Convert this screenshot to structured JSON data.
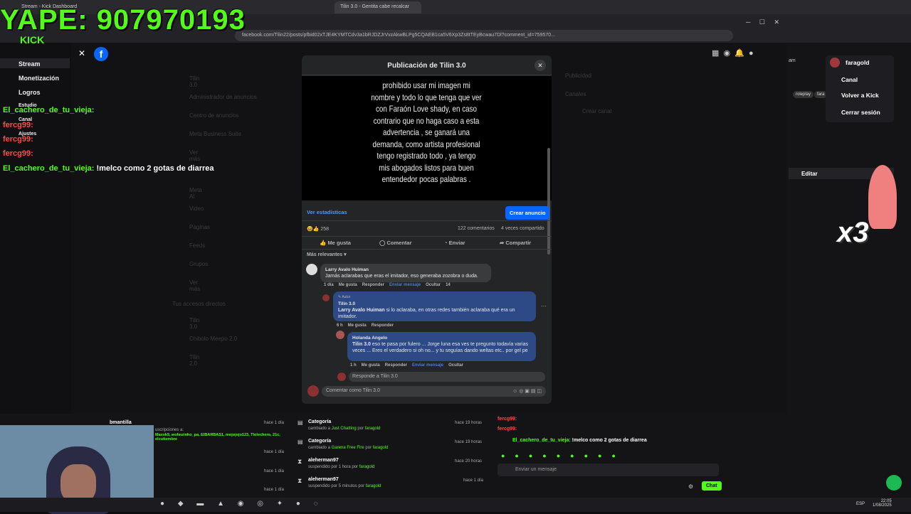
{
  "browser": {
    "tabs": [
      "Stream - Kick Dashboard",
      "Tilin 3.0 - Gentita cabe recalcar"
    ],
    "url": "facebook.com/Tilin22/posts/pfbid02xTJE4KYMTCdv3a1bRJDZJrVvzAkwBLPg5CQAEB1ca5V6Xp3Zs8tTEyBcwau7Dl?comment_id=759570..."
  },
  "overlay": {
    "yape": "YAPE: 907970193",
    "kick_logo": "KICK"
  },
  "kick_nav": [
    "Stream",
    "Monetización",
    "Logros",
    "Estudio",
    "Canal",
    "Ajustes"
  ],
  "chat_overlay": [
    {
      "user": "El_cachero_de_tu_vieja:",
      "text": ""
    },
    {
      "user": "fercg99:",
      "text": ""
    },
    {
      "user": "fercg99:",
      "text": ""
    },
    {
      "user": "fercg99:",
      "text": ""
    },
    {
      "user": "El_cachero_de_tu_vieja:",
      "text": "!melco como 2 gotas de diarrea"
    }
  ],
  "fb_sidebar": [
    "Tilin 3.0",
    "Administrador de anuncios",
    "Centro de anuncios",
    "Meta Business Suite",
    "Ver más",
    "Meta AI",
    "Video",
    "Páginas",
    "Feeds",
    "Grupos",
    "Ver más",
    "Tus accesos directos",
    "Tilin 3.0",
    "Chibolo Meepo 2.0",
    "Tilin 2.0"
  ],
  "fb_right": [
    "Publicidad",
    "Canales",
    "Crear canal"
  ],
  "modal": {
    "title": "Publicación de Tilin 3.0",
    "poem": "prohibido usar mi imagen mi nombre y todo lo que tenga que ver con Faraón Love shady, en caso contrario que no haga caso a esta advertencia , se ganará una demanda, como artista profesional tengo registrado todo , ya tengo mis abogados listos para buen entendedor pocas palabras .",
    "stats_link": "Ver estadísticas",
    "ad_button": "Crear anuncio",
    "reactions": "258",
    "comments_count": "122 comentarios",
    "shares": "4 veces compartido",
    "actions": [
      "Me gusta",
      "Comentar",
      "Enviar",
      "Compartir"
    ],
    "sort": "Más relevantes",
    "comments": [
      {
        "name": "Larry Avalo Huiman",
        "text": "Jamás aclarabas que eras el imitador, eso generaba zozobra o duda.",
        "meta": [
          "1 día",
          "Me gusta",
          "Responder",
          "Enviar mensaje",
          "Ocultar",
          "14"
        ]
      },
      {
        "badge": "Autor",
        "name": "Tilin 3.0",
        "mention": "Larry Avalo Huiman",
        "text": " si lo aclaraba, en otras redes también aclaraba qué era un imitador.",
        "meta": [
          "6 h",
          "Me gusta",
          "Responder"
        ]
      },
      {
        "name": "Holanda Angelo",
        "mention": "Tilin 3.0",
        "text": " eso te pasa por fulero ... Jorge luna esa ves te pregunto todavía varias veces ... Eres el verdadero si oh no... y tu seguías dando weltas etc.. por gel pe",
        "meta": [
          "1 h",
          "Me gusta",
          "Responder",
          "Enviar mensaje",
          "Ocultar"
        ]
      }
    ],
    "reply_placeholder": "Responde a Tilin 3.0",
    "comment_placeholder": "Comentar como Tilin 3.0"
  },
  "right_menu": {
    "user": "faragold",
    "items": [
      "Canal",
      "Volver a Kick",
      "Cerrar sesión"
    ],
    "edit": "Editar",
    "tags": [
      "roleplay",
      "fara"
    ],
    "x3": "x3"
  },
  "bottom": {
    "left_user": "bmantilla",
    "left_times": [
      "hace 1 día",
      "hace 1 día",
      "hace 1 día",
      "hace 1 día"
    ],
    "subs_text": "uscripciones a:",
    "subs_names": "Maxxk9, wohnzinho_pa, ElBARBAS1, mojojojo123, Tlolechero, 21c, elcutiembre",
    "events": [
      {
        "title": "Categoría",
        "sub": "cambiado a",
        "what": "Just Chatting",
        "by": "faragold",
        "time": "hace 19 horas"
      },
      {
        "title": "Categoría",
        "sub": "cambiado a",
        "what": "Garena Free Fire",
        "by": "faragold",
        "time": "hace 19 horas"
      },
      {
        "title": "aleherman97",
        "sub": "suspendido por 1 hora por",
        "what": "",
        "by": "faragold",
        "time": "hace 20 horas"
      },
      {
        "title": "aleherman97",
        "sub": "suspendido por 5 minutos por",
        "what": "",
        "by": "faragold",
        "time": "hace 1 día"
      }
    ],
    "chat_lines": [
      {
        "user": "fercg99:",
        "text": ""
      },
      {
        "user": "fercg99:",
        "text": ""
      },
      {
        "user": "El_cachero_de_tu_vieja:",
        "text": "!melco como 2 gotas de diarrea"
      }
    ],
    "chat_placeholder": "Enviar un mensaje",
    "chat_button": "Chat"
  },
  "taskbar": {
    "lang": "ESP",
    "time": "22:05",
    "date": "1/08/2025"
  },
  "colors": {
    "kick_green": "#53fc18",
    "fb_blue": "#0866ff"
  }
}
